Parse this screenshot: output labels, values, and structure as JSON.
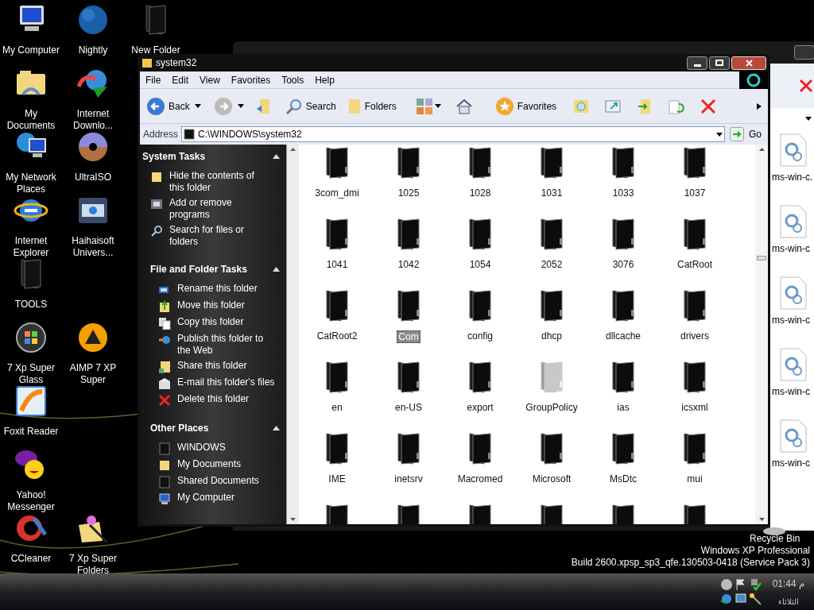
{
  "desktop": {
    "icons": [
      {
        "label": "My Computer",
        "kind": "computer"
      },
      {
        "label": "My Documents",
        "kind": "documents"
      },
      {
        "label": "My Network Places",
        "kind": "network"
      },
      {
        "label": "Internet Explorer",
        "kind": "browser"
      },
      {
        "label": "TOOLS",
        "kind": "folder"
      },
      {
        "label": "7 Xp Super Glass",
        "kind": "orb"
      },
      {
        "label": "Foxit Reader",
        "kind": "reader"
      },
      {
        "label": "Yahoo! Messenger",
        "kind": "smiley"
      },
      {
        "label": "CCleaner",
        "kind": "cleaner"
      },
      {
        "label": "Nightly",
        "kind": "globe"
      },
      {
        "label": "Internet Downlo...",
        "kind": "download"
      },
      {
        "label": "UltraISO",
        "kind": "disc"
      },
      {
        "label": "Haihaisoft Univers...",
        "kind": "film"
      },
      {
        "label": "AIMP 7 XP Super",
        "kind": "player"
      },
      {
        "label": "7 Xp Super Folders",
        "kind": "wand"
      },
      {
        "label": "New Folder",
        "kind": "folder"
      },
      {
        "label": "Recycle Bin",
        "kind": "bin"
      }
    ]
  },
  "back_window": {
    "files": [
      {
        "label": "ms-win-c."
      },
      {
        "label": "ms-win-c"
      },
      {
        "label": "ms-win-c"
      },
      {
        "label": "ms-win-c"
      },
      {
        "label": "ms-win-c"
      }
    ]
  },
  "window": {
    "title": "system32",
    "menu": [
      "File",
      "Edit",
      "View",
      "Favorites",
      "Tools",
      "Help"
    ],
    "toolbar": {
      "back": "Back",
      "search": "Search",
      "folders": "Folders",
      "favorites": "Favorites"
    },
    "address": {
      "label": "Address",
      "value": "C:\\WINDOWS\\system32",
      "go": "Go"
    },
    "sidebar": [
      {
        "title": "System Tasks",
        "expanded": true,
        "items": [
          {
            "label": "Hide the contents of this folder",
            "kind": "folder"
          },
          {
            "label": "Add or remove programs",
            "kind": "programs"
          },
          {
            "label": "Search for files or folders",
            "kind": "search"
          }
        ]
      },
      {
        "title": "File and Folder Tasks",
        "expanded": true,
        "items": [
          {
            "label": "Rename this folder",
            "kind": "rename"
          },
          {
            "label": "Move this folder",
            "kind": "move"
          },
          {
            "label": "Copy this folder",
            "kind": "copy"
          },
          {
            "label": "Publish this folder to the Web",
            "kind": "web"
          },
          {
            "label": "Share this folder",
            "kind": "share"
          },
          {
            "label": "E-mail this folder's files",
            "kind": "mail"
          },
          {
            "label": "Delete this folder",
            "kind": "delete"
          }
        ]
      },
      {
        "title": "Other Places",
        "expanded": true,
        "items": [
          {
            "label": "WINDOWS",
            "kind": "darkfolder"
          },
          {
            "label": "My Documents",
            "kind": "folder"
          },
          {
            "label": "Shared Documents",
            "kind": "darkfolder"
          },
          {
            "label": "My Computer",
            "kind": "computer"
          }
        ]
      }
    ],
    "folders": [
      {
        "label": "3com_dmi",
        "selected": false,
        "hidden": false
      },
      {
        "label": "1025",
        "selected": false,
        "hidden": false
      },
      {
        "label": "1028",
        "selected": false,
        "hidden": false
      },
      {
        "label": "1031",
        "selected": false,
        "hidden": false
      },
      {
        "label": "1033",
        "selected": false,
        "hidden": false
      },
      {
        "label": "1037",
        "selected": false,
        "hidden": false
      },
      {
        "label": "1041",
        "selected": false,
        "hidden": false
      },
      {
        "label": "1042",
        "selected": false,
        "hidden": false
      },
      {
        "label": "1054",
        "selected": false,
        "hidden": false
      },
      {
        "label": "2052",
        "selected": false,
        "hidden": false
      },
      {
        "label": "3076",
        "selected": false,
        "hidden": false
      },
      {
        "label": "CatRoot",
        "selected": false,
        "hidden": false
      },
      {
        "label": "CatRoot2",
        "selected": false,
        "hidden": false
      },
      {
        "label": "Com",
        "selected": true,
        "hidden": false
      },
      {
        "label": "config",
        "selected": false,
        "hidden": false
      },
      {
        "label": "dhcp",
        "selected": false,
        "hidden": false
      },
      {
        "label": "dllcache",
        "selected": false,
        "hidden": false
      },
      {
        "label": "drivers",
        "selected": false,
        "hidden": false
      },
      {
        "label": "en",
        "selected": false,
        "hidden": false
      },
      {
        "label": "en-US",
        "selected": false,
        "hidden": false
      },
      {
        "label": "export",
        "selected": false,
        "hidden": false
      },
      {
        "label": "GroupPolicy",
        "selected": false,
        "hidden": true
      },
      {
        "label": "ias",
        "selected": false,
        "hidden": false
      },
      {
        "label": "icsxml",
        "selected": false,
        "hidden": false
      },
      {
        "label": "IME",
        "selected": false,
        "hidden": false
      },
      {
        "label": "inetsrv",
        "selected": false,
        "hidden": false
      },
      {
        "label": "Macromed",
        "selected": false,
        "hidden": false
      },
      {
        "label": "Microsoft",
        "selected": false,
        "hidden": false
      },
      {
        "label": "MsDtc",
        "selected": false,
        "hidden": false
      },
      {
        "label": "mui",
        "selected": false,
        "hidden": false
      }
    ]
  },
  "watermark": [
    "Windows XP Professional",
    "Build 2600.xpsp_sp3_qfe.130503-0418 (Service Pack 3)"
  ],
  "tray": {
    "time": "01:44 م",
    "day": "الثلاثاء"
  }
}
